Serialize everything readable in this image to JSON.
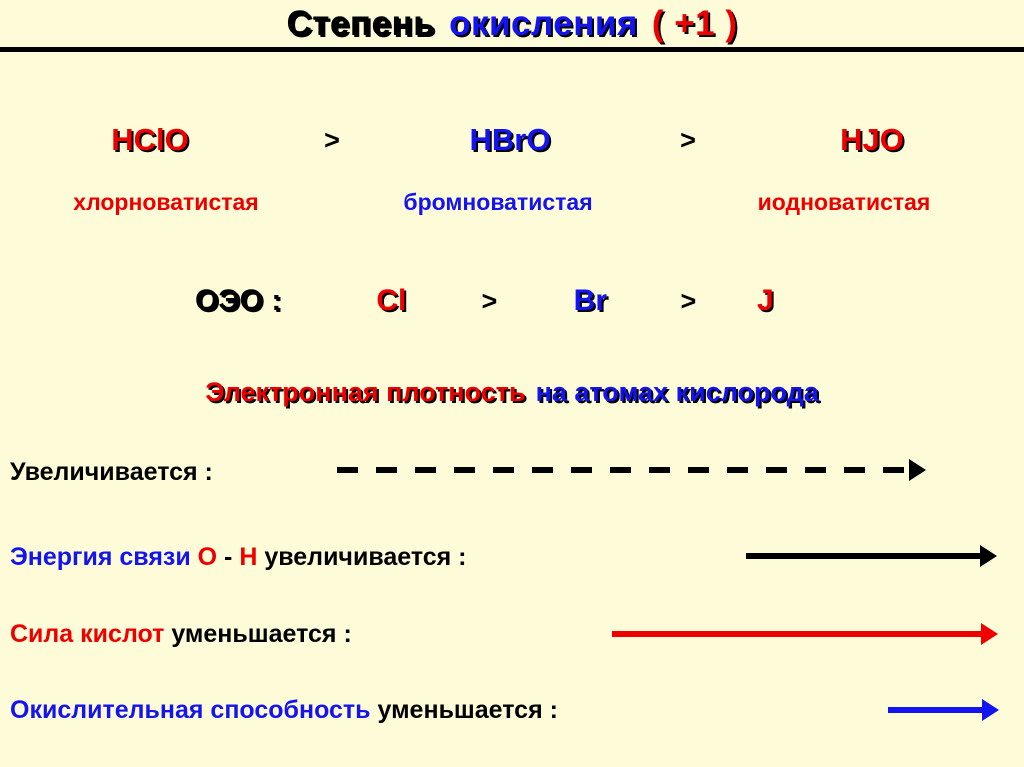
{
  "header": {
    "title_part1": "Степень",
    "title_part2": "окисления",
    "title_part3": "( +1 )"
  },
  "colors": {
    "background": "#fdfbd8",
    "red": "#ee0000",
    "blue": "#1414f0",
    "black": "#000000"
  },
  "acids": {
    "items": [
      {
        "formula": "HClO",
        "name": "хлорноватистая",
        "color": "#ee0000"
      },
      {
        "formula": "HBrO",
        "name": "бромноватистая",
        "color": "#1414f0"
      },
      {
        "formula": "HJO",
        "name": "иодноватистая",
        "color": "#ee0000"
      }
    ],
    "separator": ">"
  },
  "oeo": {
    "label": "ОЭО :",
    "items": [
      {
        "symbol": "Cl",
        "color": "#ee0000"
      },
      {
        "symbol": "Br",
        "color": "#1414f0"
      },
      {
        "symbol": "J",
        "color": "#ee0000"
      }
    ],
    "separator": ">"
  },
  "electron_density": {
    "part1": "Электронная плотность",
    "part2": "на атомах кислорода"
  },
  "statements": [
    {
      "id": "increase",
      "segments": [
        {
          "text": "Увеличивается :",
          "color": "#000000"
        }
      ],
      "arrow": {
        "style": "dashed",
        "color": "#000000"
      }
    },
    {
      "id": "bond-energy",
      "segments": [
        {
          "text": "Энергия связи ",
          "color": "#1414f0"
        },
        {
          "text": "O",
          "color": "#ee0000"
        },
        {
          "text": " - ",
          "color": "#000000"
        },
        {
          "text": "H",
          "color": "#ee0000"
        },
        {
          "text": " увеличивается :",
          "color": "#000000"
        }
      ],
      "arrow": {
        "style": "solid",
        "color": "#000000"
      }
    },
    {
      "id": "acid-strength",
      "segments": [
        {
          "text": "Сила кислот",
          "color": "#ee0000"
        },
        {
          "text": " уменьшается :",
          "color": "#000000"
        }
      ],
      "arrow": {
        "style": "solid",
        "color": "#ee0000"
      }
    },
    {
      "id": "oxidizing-ability",
      "segments": [
        {
          "text": "Окислительная способность",
          "color": "#1414f0"
        },
        {
          "text": " уменьшается :",
          "color": "#000000"
        }
      ],
      "arrow": {
        "style": "solid",
        "color": "#1414f0"
      }
    }
  ]
}
